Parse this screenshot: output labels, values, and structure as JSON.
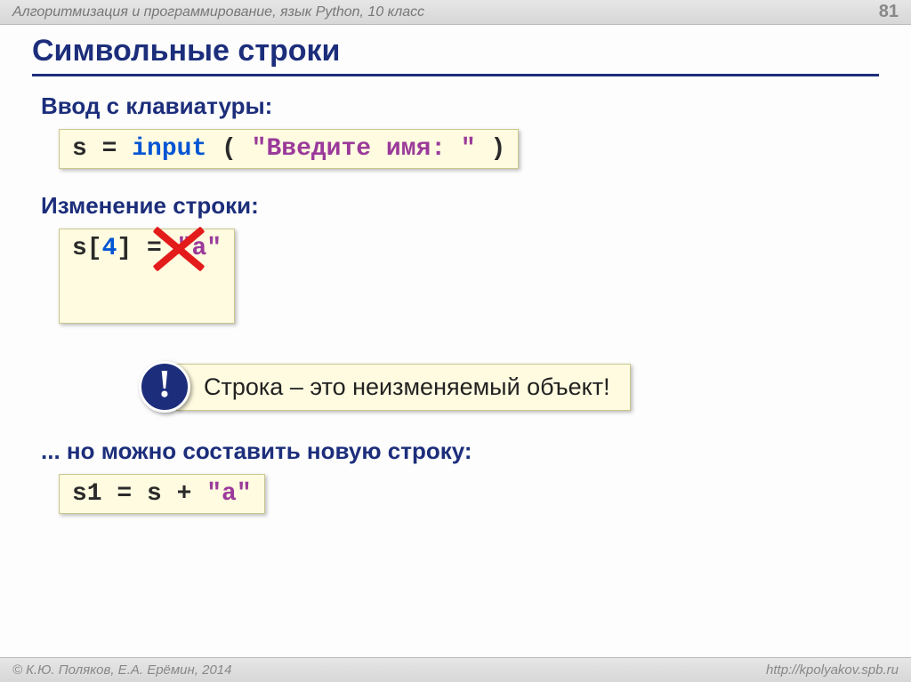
{
  "header": {
    "course": "Алгоритмизация и программирование, язык Python, 10 класс",
    "page": "81"
  },
  "title": "Символьные строки",
  "sec1": {
    "heading": "Ввод с клавиатуры:",
    "code": {
      "var": "s",
      "eq": " = ",
      "kw": "input",
      "open": " ( ",
      "str": "\"Введите имя: \"",
      "close": " )"
    }
  },
  "sec2": {
    "heading": "Изменение строки:",
    "code": {
      "p1": "s[",
      "num": "4",
      "p2": "] = ",
      "str": "\"a\""
    }
  },
  "callout": {
    "mark": "!",
    "text": "Строка – это неизменяемый объект!"
  },
  "sec3": {
    "heading": "... но можно составить новую строку:",
    "code": {
      "p1": "s1 = s + ",
      "str": "\"a\""
    }
  },
  "footer": {
    "copyright": "К.Ю. Поляков, Е.А. Ерёмин, 2014",
    "url": "http://kpolyakov.spb.ru"
  }
}
